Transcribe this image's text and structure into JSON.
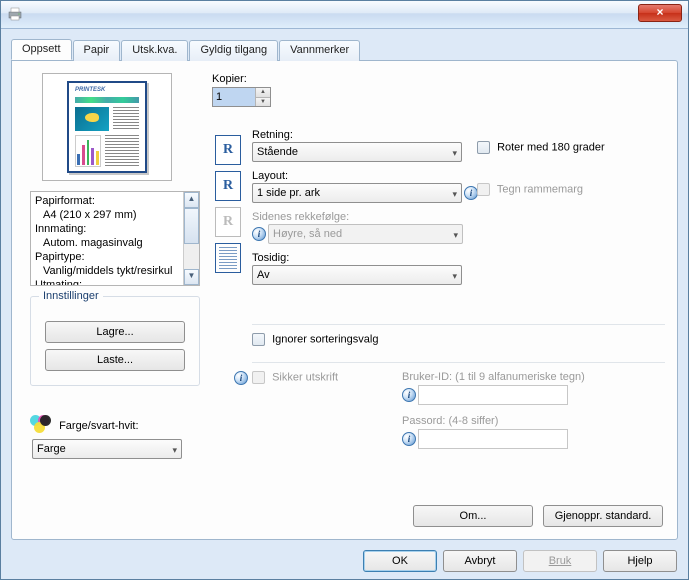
{
  "titlebar": {
    "close_glyph": "×"
  },
  "tabs": {
    "t0": "Oppsett",
    "t1": "Papir",
    "t2": "Utsk.kva.",
    "t3": "Gyldig tilgang",
    "t4": "Vannmerker"
  },
  "preview": {
    "heading": "PRINTESK"
  },
  "settings_list": {
    "l0": "Papirformat:",
    "l0v": "A4 (210 x 297 mm)",
    "l1": "Innmating:",
    "l1v": "Autom. magasinvalg",
    "l2": "Papirtype:",
    "l2v": "Vanlig/middels tykt/resirkul",
    "l3": "Utmating:"
  },
  "settings_group": {
    "title": "Innstillinger",
    "save": "Lagre...",
    "load": "Laste..."
  },
  "color": {
    "label": "Farge/svart-hvit:",
    "value": "Farge"
  },
  "copies": {
    "label": "Kopier:",
    "value": "1"
  },
  "orientation": {
    "label": "Retning:",
    "value": "Stående",
    "rotate180": "Roter med 180 grader"
  },
  "layout": {
    "label": "Layout:",
    "value": "1 side pr. ark",
    "frame": "Tegn rammemarg"
  },
  "order": {
    "label": "Sidenes rekkefølge:",
    "value": "Høyre, så ned"
  },
  "duplex": {
    "label": "Tosidig:",
    "value": "Av"
  },
  "ignore_sort": "Ignorer sorteringsvalg",
  "secure_print": "Sikker utskrift",
  "userid": {
    "label": "Bruker-ID: (1 til 9 alfanumeriske tegn)"
  },
  "password": {
    "label": "Passord: (4-8 siffer)"
  },
  "panel_buttons": {
    "about": "Om...",
    "restore": "Gjenoppr. standard."
  },
  "dialog_buttons": {
    "ok": "OK",
    "cancel": "Avbryt",
    "apply": "Bruk",
    "help": "Hjelp"
  },
  "thumbs": {
    "r": "R"
  }
}
